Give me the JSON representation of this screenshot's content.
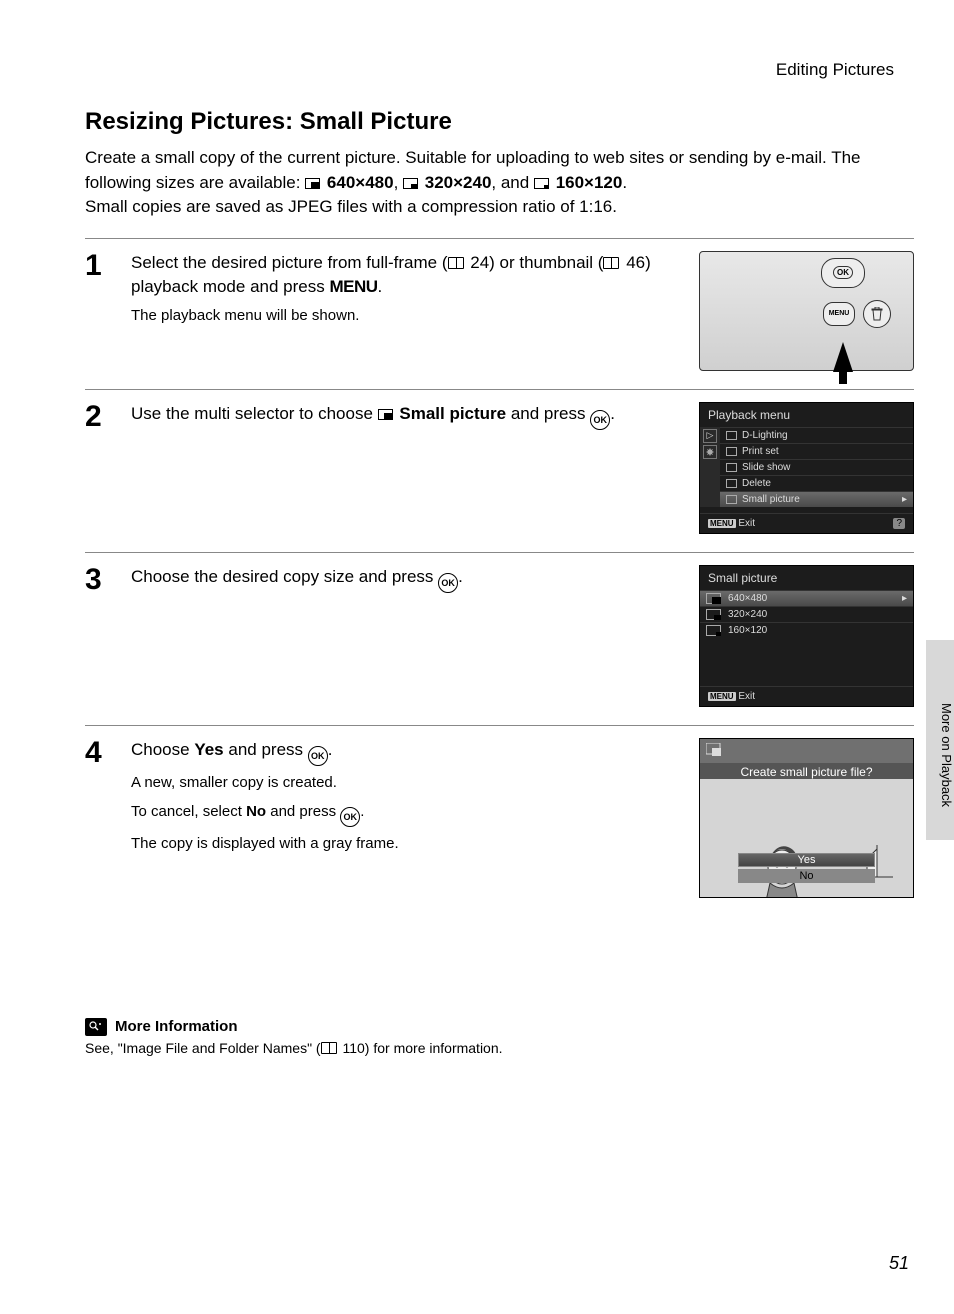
{
  "section_header": "Editing Pictures",
  "title": "Resizing Pictures: Small Picture",
  "intro_line1a": "Create a small copy of the current picture. Suitable for uploading to web sites or sending by e-mail. The following sizes are available: ",
  "size1": "640×480",
  "size2": "320×240",
  "intro_and": ", and ",
  "size3": "160×120",
  "intro_line2": "Small copies are saved as JPEG files with a compression ratio of 1:16.",
  "steps": {
    "s1": {
      "num": "1",
      "main_a": "Select the desired picture from full-frame (",
      "ref1": " 24) or thumbnail (",
      "ref2": " 46) playback mode and press ",
      "menu": "MENU",
      "main_end": ".",
      "sub": "The playback menu will be shown."
    },
    "s2": {
      "num": "2",
      "main_a": "Use the multi selector to choose ",
      "bold": "Small picture",
      "main_b": " and press ",
      "ok": "OK",
      "end": "."
    },
    "s3": {
      "num": "3",
      "main_a": "Choose the desired copy size and press ",
      "ok": "OK",
      "end": "."
    },
    "s4": {
      "num": "4",
      "main_a": "Choose ",
      "yes": "Yes",
      "main_b": " and press ",
      "ok": "OK",
      "end": ".",
      "sub1": "A new, smaller copy is created.",
      "sub2a": "To cancel, select ",
      "no": "No",
      "sub2b": " and press ",
      "sub3": "The copy is displayed with a gray frame."
    }
  },
  "lcd2": {
    "title": "Playback menu",
    "items": [
      "D-Lighting",
      "Print set",
      "Slide show",
      "Delete",
      "Small picture"
    ],
    "exit": "Exit",
    "menu_label": "MENU",
    "help": "?"
  },
  "lcd3": {
    "title": "Small picture",
    "items": [
      "640×480",
      "320×240",
      "160×120"
    ],
    "exit": "Exit",
    "menu_label": "MENU"
  },
  "confirm": {
    "question": "Create small picture file?",
    "yes": "Yes",
    "no": "No"
  },
  "cam": {
    "ok": "OK",
    "menu": "MENU"
  },
  "sidetab": "More on Playback",
  "more_info": {
    "heading": "More Information",
    "body_a": "See, \"Image File and Folder Names\" (",
    "ref": " 110) for more information."
  },
  "pagenum": "51"
}
